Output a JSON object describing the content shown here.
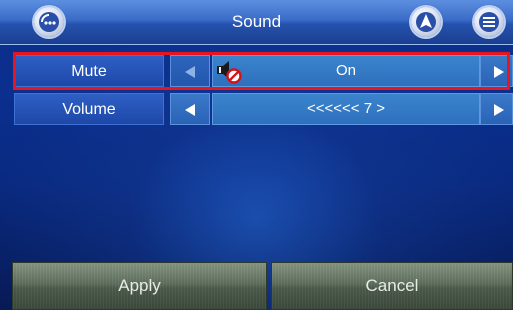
{
  "header": {
    "title": "Sound",
    "left_icon": "back-ellipsis-icon",
    "nav_icon": "navigation-arrow-icon",
    "menu_icon": "list-menu-icon"
  },
  "settings": [
    {
      "label": "Mute",
      "value": "On",
      "value_icon": "mute-speaker-icon",
      "left_arrow_enabled": false,
      "right_arrow_enabled": true,
      "selected": true
    },
    {
      "label": "Volume",
      "value": "<<<<<< 7 >",
      "left_arrow_enabled": true,
      "right_arrow_enabled": true,
      "selected": false
    }
  ],
  "buttons": {
    "apply": "Apply",
    "cancel": "Cancel"
  },
  "colors": {
    "highlight": "#e8141e",
    "background": "#0b2f8f",
    "button": "#5f6f5e"
  }
}
